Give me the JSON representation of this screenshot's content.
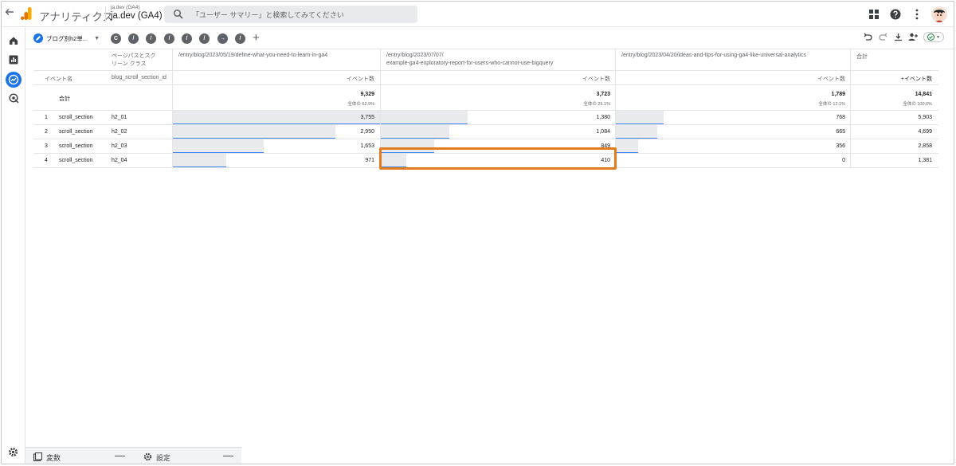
{
  "topbar": {
    "back_icon": "arrow-left-icon",
    "app_name": "アナリティクス",
    "property_small": "ja.dev (GA4)",
    "property_name": "ja.dev (GA4)",
    "search_placeholder": "「ユーザー サマリー」と検索してみてください"
  },
  "tabs": {
    "active_label": "ブログ別h2単...",
    "other_tabs": [
      "C",
      "/",
      "/",
      "/",
      "/",
      "/",
      "→",
      "/"
    ],
    "add_label": "+"
  },
  "table": {
    "dim_header_1": "ページパスとスク",
    "dim_header_1b": "リーン クラス",
    "dim_header_2": "blog_scroll_section_id",
    "row_header_1": "イベント名",
    "col1_path": "/entry/blog/2023/05/19/define-what-you-need-to-learn-in-ga4",
    "col2_path_a": "/entry/blog/2023/07/07/",
    "col2_path_b": "example-ga4-exploratory-report-for-users-who-cannot-use-bigquery",
    "col3_path": "/entry/blog/2023/04/20/ideas-and-tips-for-using-ga4-like-universal-analytics",
    "col4_header": "合計",
    "metric": "イベント数",
    "metric_total": "+イベント数",
    "total_label": "合計",
    "totals": [
      {
        "value": "9,329",
        "share": "全体の 62.9%"
      },
      {
        "value": "3,723",
        "share": "全体の 25.1%"
      },
      {
        "value": "1,789",
        "share": "全体の 12.1%"
      },
      {
        "value": "14,841",
        "share": "全体の 100.0%"
      }
    ],
    "rows": [
      {
        "num": "1",
        "event": "scroll_section",
        "id": "h2_01",
        "c1": "3,755",
        "c2": "1,380",
        "c3": "768",
        "total": "5,903"
      },
      {
        "num": "2",
        "event": "scroll_section",
        "id": "h2_02",
        "c1": "2,950",
        "c2": "1,084",
        "c3": "665",
        "total": "4,699"
      },
      {
        "num": "3",
        "event": "scroll_section",
        "id": "h2_03",
        "c1": "1,653",
        "c2": "849",
        "c3": "356",
        "total": "2,858"
      },
      {
        "num": "4",
        "event": "scroll_section",
        "id": "h2_04",
        "c1": "971",
        "c2": "410",
        "c3": "0",
        "total": "1,381"
      }
    ]
  },
  "bottom": {
    "variables_label": "変数",
    "settings_label": "設定",
    "collapse_label": "—"
  },
  "colors": {
    "accent": "#1a73e8",
    "bar_fill": "#e8eaed",
    "bar_line": "#4285f4",
    "highlight": "#e37b1f"
  }
}
